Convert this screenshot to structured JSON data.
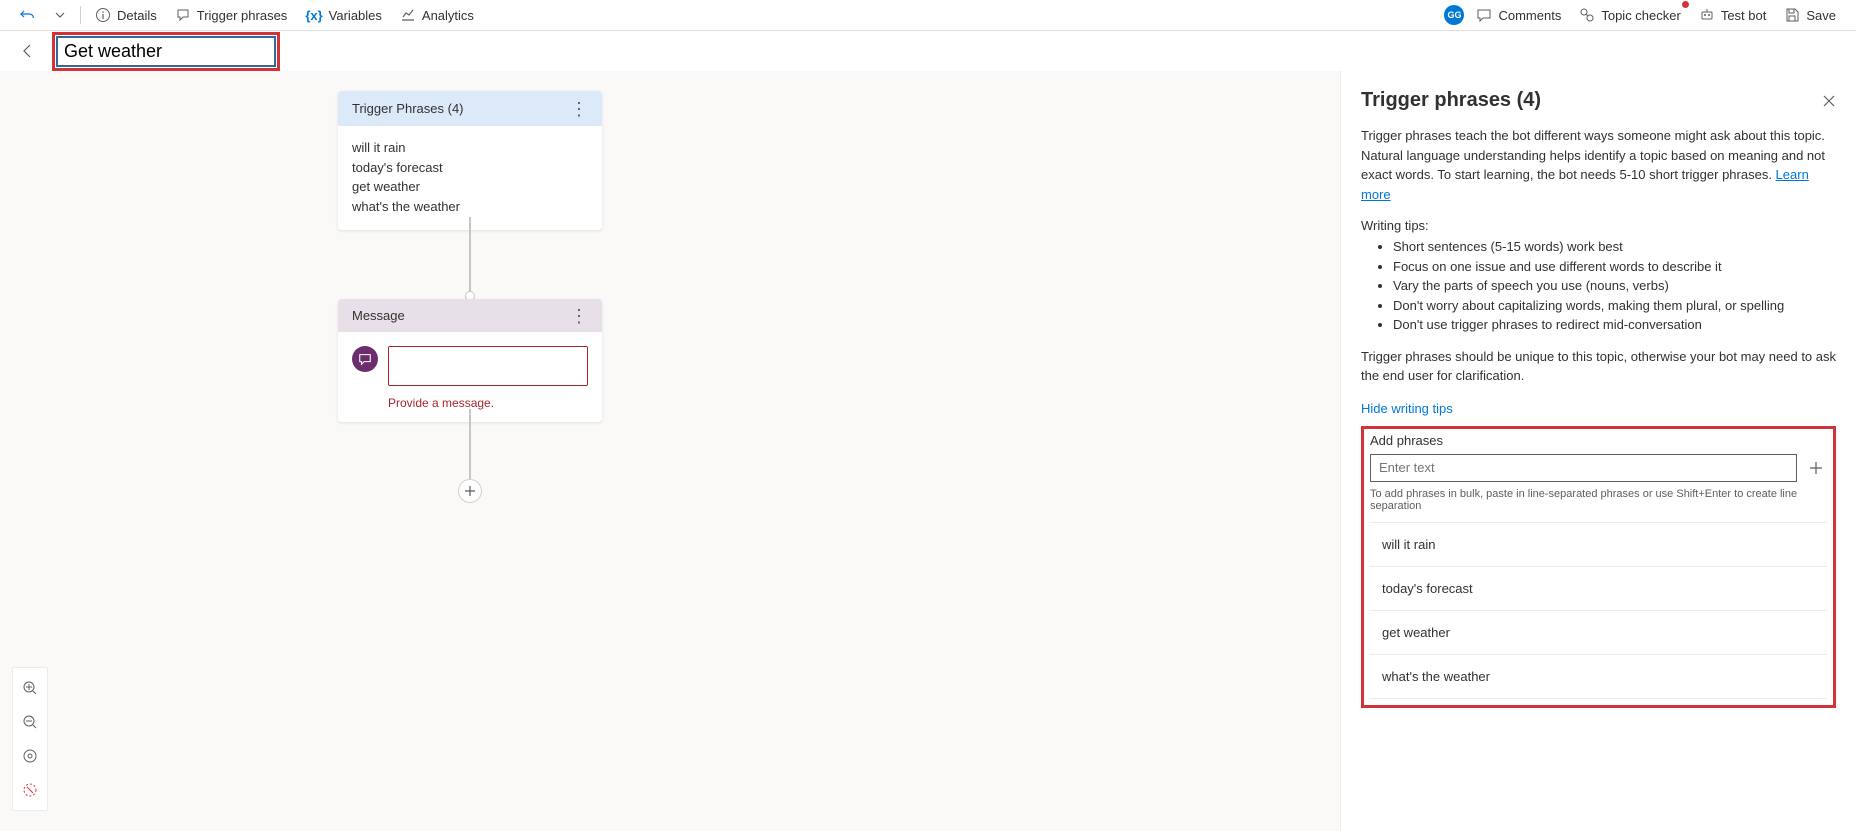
{
  "topbar": {
    "details": "Details",
    "trigger_phrases": "Trigger phrases",
    "variables": "Variables",
    "analytics": "Analytics",
    "avatar": "GG",
    "comments": "Comments",
    "topic_checker": "Topic checker",
    "test_bot": "Test bot",
    "save": "Save"
  },
  "title": "Get weather",
  "trigger_node": {
    "title": "Trigger Phrases (4)",
    "phrases": [
      "will it rain",
      "today's forecast",
      "get weather",
      "what's the weather"
    ]
  },
  "message_node": {
    "title": "Message",
    "error": "Provide a message."
  },
  "sidepanel": {
    "title": "Trigger phrases (4)",
    "desc_pre": "Trigger phrases teach the bot different ways someone might ask about this topic. Natural language understanding helps identify a topic based on meaning and not exact words. To start learning, the bot needs 5-10 short trigger phrases. ",
    "learn_more": "Learn more",
    "tips_title": "Writing tips:",
    "tips": [
      "Short sentences (5-15 words) work best",
      "Focus on one issue and use different words to describe it",
      "Vary the parts of speech you use (nouns, verbs)",
      "Don't worry about capitalizing words, making them plural, or spelling",
      "Don't use trigger phrases to redirect mid-conversation"
    ],
    "note": "Trigger phrases should be unique to this topic, otherwise your bot may need to ask the end user for clarification.",
    "hide": "Hide writing tips",
    "add_label": "Add phrases",
    "add_placeholder": "Enter text",
    "add_hint": "To add phrases in bulk, paste in line-separated phrases or use Shift+Enter to create line separation",
    "phrases": [
      "will it rain",
      "today's forecast",
      "get weather",
      "what's the weather"
    ]
  }
}
